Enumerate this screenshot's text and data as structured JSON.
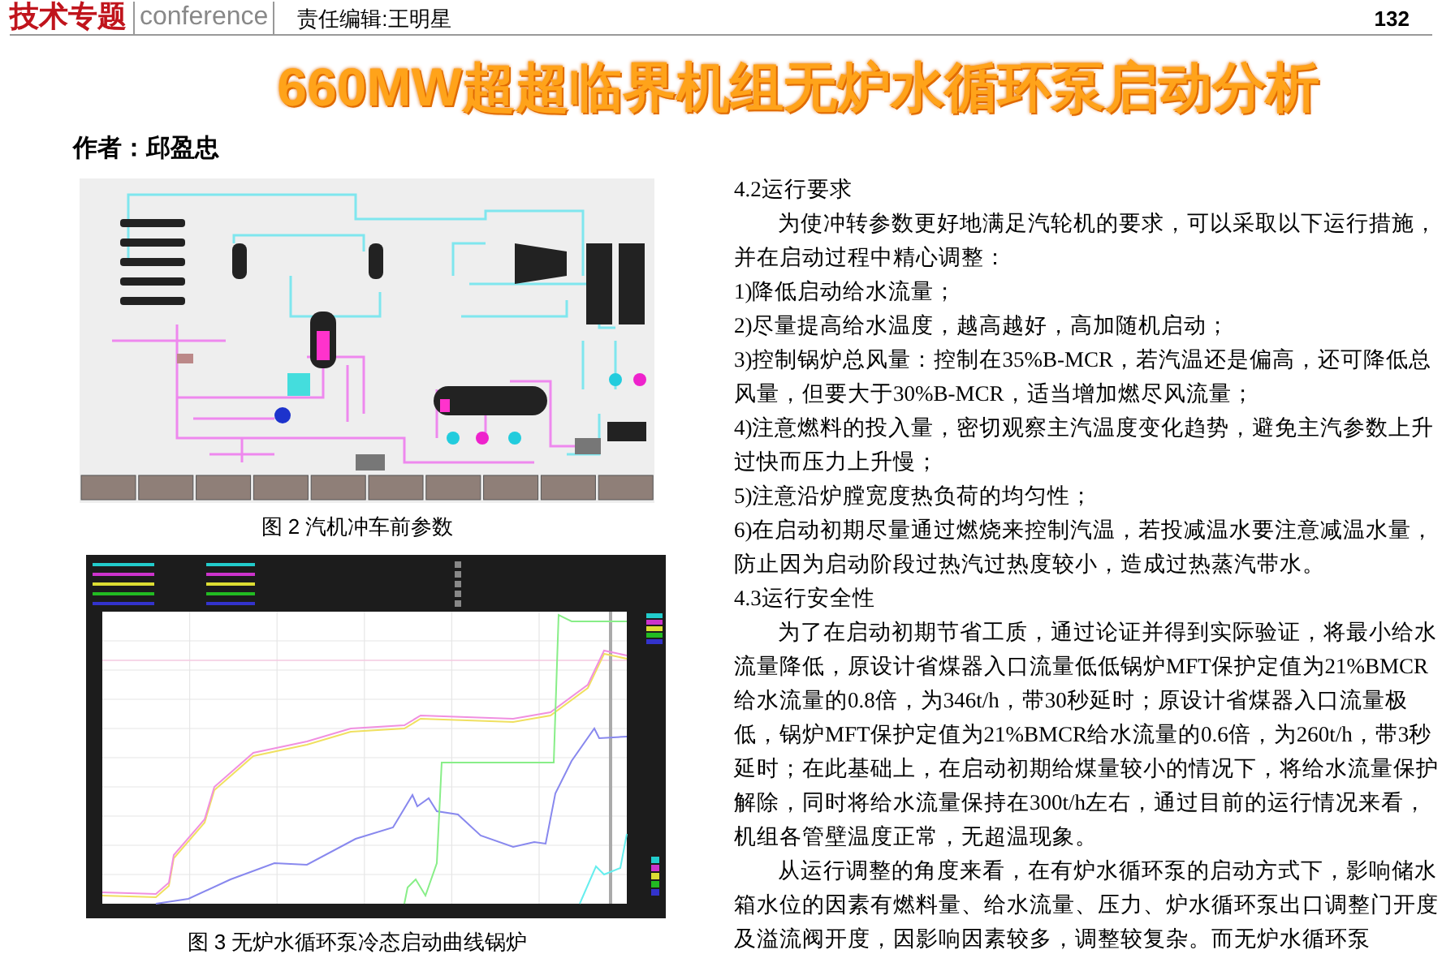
{
  "header": {
    "section": "技术专题",
    "tag": "conference",
    "editor": "责任编辑:王明星",
    "page_number": "132"
  },
  "title": "660MW超超临界机组无炉水循环泵启动分析",
  "author": "作者：邱盈忠",
  "figures": [
    {
      "kind": "diagram",
      "caption": "图 2 汽机冲车前参数"
    },
    {
      "kind": "trend",
      "caption": "图 3 无炉水循环泵冷态启动曲线锅炉"
    }
  ],
  "body": [
    {
      "kind": "heading",
      "text": "4.2运行要求"
    },
    {
      "kind": "paragraph",
      "text": "为使冲转参数更好地满足汽轮机的要求，可以采取以下运行措施，并在启动过程中精心调整："
    },
    {
      "kind": "item",
      "text": "1)降低启动给水流量；"
    },
    {
      "kind": "item",
      "text": "2)尽量提高给水温度，越高越好，高加随机启动；"
    },
    {
      "kind": "item",
      "text": "3)控制锅炉总风量：控制在35%B-MCR，若汽温还是偏高，还可降低总风量，但要大于30%B-MCR，适当增加燃尽风流量；"
    },
    {
      "kind": "item",
      "text": "4)注意燃料的投入量，密切观察主汽温度变化趋势，避免主汽参数上升过快而压力上升慢；"
    },
    {
      "kind": "item",
      "text": "5)注意沿炉膛宽度热负荷的均匀性；"
    },
    {
      "kind": "item",
      "text": "6)在启动初期尽量通过燃烧来控制汽温，若投减温水要注意减温水量，防止因为启动阶段过热汽过热度较小，造成过热蒸汽带水。"
    },
    {
      "kind": "heading",
      "text": "4.3运行安全性"
    },
    {
      "kind": "paragraph",
      "text": "为了在启动初期节省工质，通过论证并得到实际验证，将最小给水流量降低，原设计省煤器入口流量低低锅炉MFT保护定值为21%BMCR给水流量的0.8倍，为346t/h，带30秒延时；原设计省煤器入口流量极低，锅炉MFT保护定值为21%BMCR给水流量的0.6倍，为260t/h，带3秒延时；在此基础上，在启动初期给煤量较小的情况下，将给水流量保护解除，同时将给水流量保持在300t/h左右，通过目前的运行情况来看，机组各管壁温度正常，无超温现象。"
    },
    {
      "kind": "paragraph",
      "text": "从运行调整的角度来看，在有炉水循环泵的启动方式下，影响储水箱水位的因素有燃料量、给水流量、压力、炉水循环泵出口调整门开度及溢流阀开度，因影响因素较多，调整较复杂。而无炉水循环泵"
    }
  ]
}
